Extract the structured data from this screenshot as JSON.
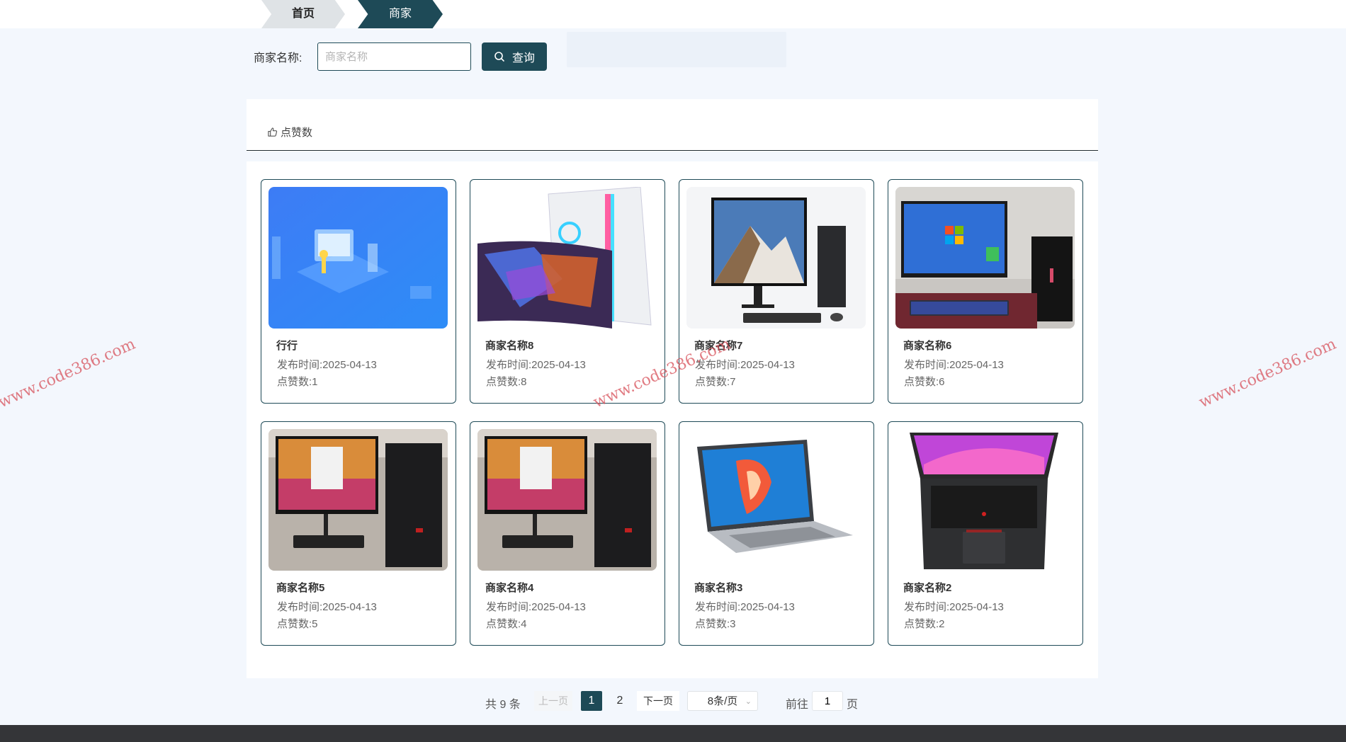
{
  "breadcrumb": {
    "home": "首页",
    "current": "商家"
  },
  "search": {
    "label": "商家名称:",
    "placeholder": "商家名称",
    "value": "",
    "button": "查询"
  },
  "sort": {
    "label": "点赞数"
  },
  "cards": [
    {
      "name": "行行",
      "time": "发布时间:2025-04-13",
      "likes": "点赞数:1",
      "image": "isometric-office-illustration"
    },
    {
      "name": "商家名称8",
      "time": "发布时间:2025-04-13",
      "likes": "点赞数:8",
      "image": "gaming-pc-with-curved-monitor"
    },
    {
      "name": "商家名称7",
      "time": "发布时间:2025-04-13",
      "likes": "点赞数:7",
      "image": "desktop-with-mountain-wallpaper"
    },
    {
      "name": "商家名称6",
      "time": "发布时间:2025-04-13",
      "likes": "点赞数:6",
      "image": "windows-desktop-setup"
    },
    {
      "name": "商家名称5",
      "time": "发布时间:2025-04-13",
      "likes": "点赞数:5",
      "image": "desktop-pc-and-monitor"
    },
    {
      "name": "商家名称4",
      "time": "发布时间:2025-04-13",
      "likes": "点赞数:4",
      "image": "desktop-pc-and-monitor"
    },
    {
      "name": "商家名称3",
      "time": "发布时间:2025-04-13",
      "likes": "点赞数:3",
      "image": "silver-laptop"
    },
    {
      "name": "商家名称2",
      "time": "发布时间:2025-04-13",
      "likes": "点赞数:2",
      "image": "thinkpad-laptop"
    }
  ],
  "pagination": {
    "total": "共 9 条",
    "prev": "上一页",
    "pages": [
      "1",
      "2"
    ],
    "next": "下一页",
    "page_size": "8条/页",
    "goto": "前往",
    "goto_value": "1",
    "unit": "页"
  },
  "watermark": "www.code386.com",
  "colors": {
    "primary": "#1e4a57",
    "background": "#f3f7fd",
    "footer": "#343538",
    "watermark": "#d7505a"
  }
}
